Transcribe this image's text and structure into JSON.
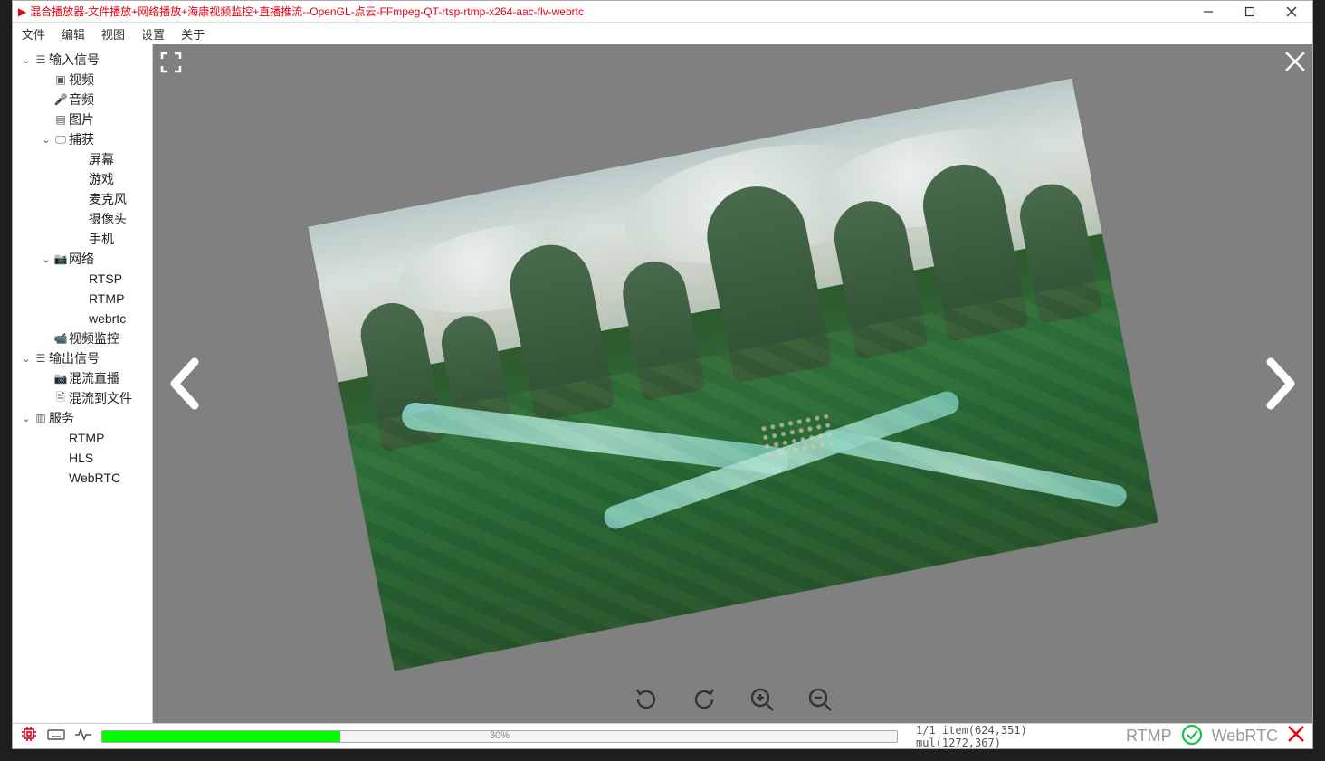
{
  "window": {
    "title": "混合播放器-文件播放+网络播放+海康视频监控+直播推流--OpenGL-点云-FFmpeg-QT-rtsp-rtmp-x264-aac-flv-webrtc"
  },
  "menu": {
    "items": [
      "文件",
      "编辑",
      "视图",
      "设置",
      "关于"
    ]
  },
  "tree": [
    {
      "depth": 0,
      "chev": "▾",
      "icon": "layers",
      "label": "输入信号"
    },
    {
      "depth": 1,
      "chev": "",
      "icon": "video",
      "label": "视频"
    },
    {
      "depth": 1,
      "chev": "",
      "icon": "mic",
      "label": "音频"
    },
    {
      "depth": 1,
      "chev": "",
      "icon": "image",
      "label": "图片"
    },
    {
      "depth": 1,
      "chev": "▾",
      "icon": "monitor",
      "label": "捕获"
    },
    {
      "depth": 2,
      "chev": "",
      "icon": "",
      "label": "屏幕"
    },
    {
      "depth": 2,
      "chev": "",
      "icon": "",
      "label": "游戏"
    },
    {
      "depth": 2,
      "chev": "",
      "icon": "",
      "label": "麦克风"
    },
    {
      "depth": 2,
      "chev": "",
      "icon": "",
      "label": "摄像头"
    },
    {
      "depth": 2,
      "chev": "",
      "icon": "",
      "label": "手机"
    },
    {
      "depth": 1,
      "chev": "▾",
      "icon": "cam",
      "label": "网络"
    },
    {
      "depth": 2,
      "chev": "",
      "icon": "",
      "label": "RTSP"
    },
    {
      "depth": 2,
      "chev": "",
      "icon": "",
      "label": "RTMP"
    },
    {
      "depth": 2,
      "chev": "",
      "icon": "",
      "label": "webrtc"
    },
    {
      "depth": 1,
      "chev": "",
      "icon": "cctv",
      "label": "视频监控"
    },
    {
      "depth": 0,
      "chev": "▾",
      "icon": "layers",
      "label": "输出信号"
    },
    {
      "depth": 1,
      "chev": "",
      "icon": "cam",
      "label": "混流直播"
    },
    {
      "depth": 1,
      "chev": "",
      "icon": "file",
      "label": "混流到文件"
    },
    {
      "depth": 0,
      "chev": "▾",
      "icon": "server",
      "label": "服务"
    },
    {
      "depth": 1,
      "chev": "",
      "icon": "",
      "label": "RTMP"
    },
    {
      "depth": 1,
      "chev": "",
      "icon": "",
      "label": "HLS"
    },
    {
      "depth": 1,
      "chev": "",
      "icon": "",
      "label": "WebRTC"
    }
  ],
  "viewer": {
    "tools": [
      "rotate-ccw",
      "rotate-cw",
      "zoom-in",
      "zoom-out"
    ]
  },
  "status": {
    "progress_pct": "30%",
    "progress_fill": "30%",
    "info": "1/1 item(624,351) mul(1272,367)",
    "rtmp_label": "RTMP",
    "webrtc_label": "WebRTC"
  }
}
